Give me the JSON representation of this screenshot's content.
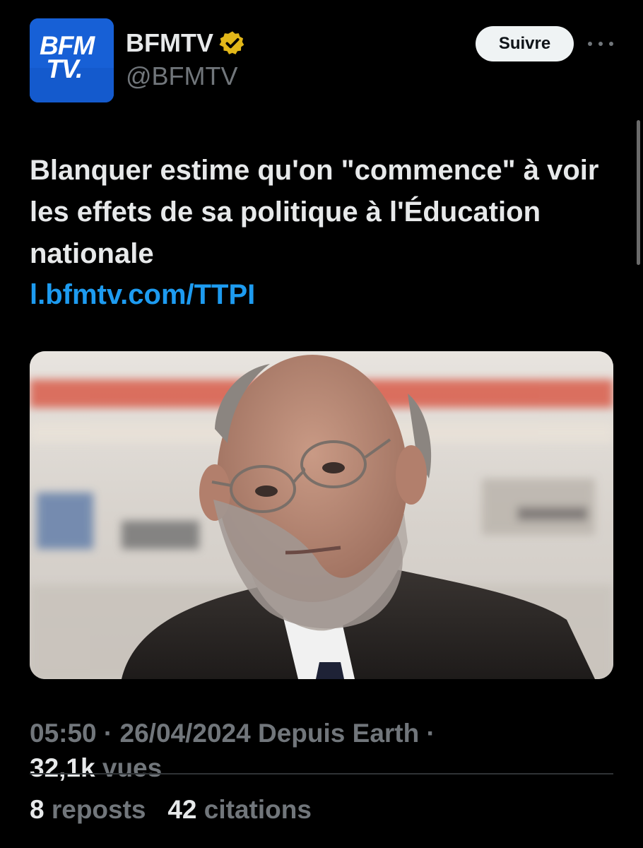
{
  "account": {
    "avatar_logo_text": "BFM TV.",
    "display_name": "BFMTV",
    "handle": "@BFMTV",
    "verified_badge_color": "#e2b719"
  },
  "actions": {
    "follow_label": "Suivre",
    "more_icon": "more-horizontal-icon"
  },
  "tweet": {
    "text": "Blanquer estime qu'on \"commence\" à voir les effets de sa politique à l'Éducation nationale",
    "link": "l.bfmtv.com/TTPI"
  },
  "meta": {
    "time": "05:50",
    "date": "26/04/2024",
    "source": "Depuis Earth",
    "separator": "·"
  },
  "views": {
    "count": "32,1k",
    "label": "vues"
  },
  "stats": {
    "reposts_count": "8",
    "reposts_label": "reposts",
    "quotes_count": "42",
    "quotes_label": "citations"
  },
  "colors": {
    "background": "#000000",
    "text_primary": "#e7e9ea",
    "text_secondary": "#71767b",
    "link": "#1d9bf0",
    "brand_blue": "#1a63d6"
  }
}
